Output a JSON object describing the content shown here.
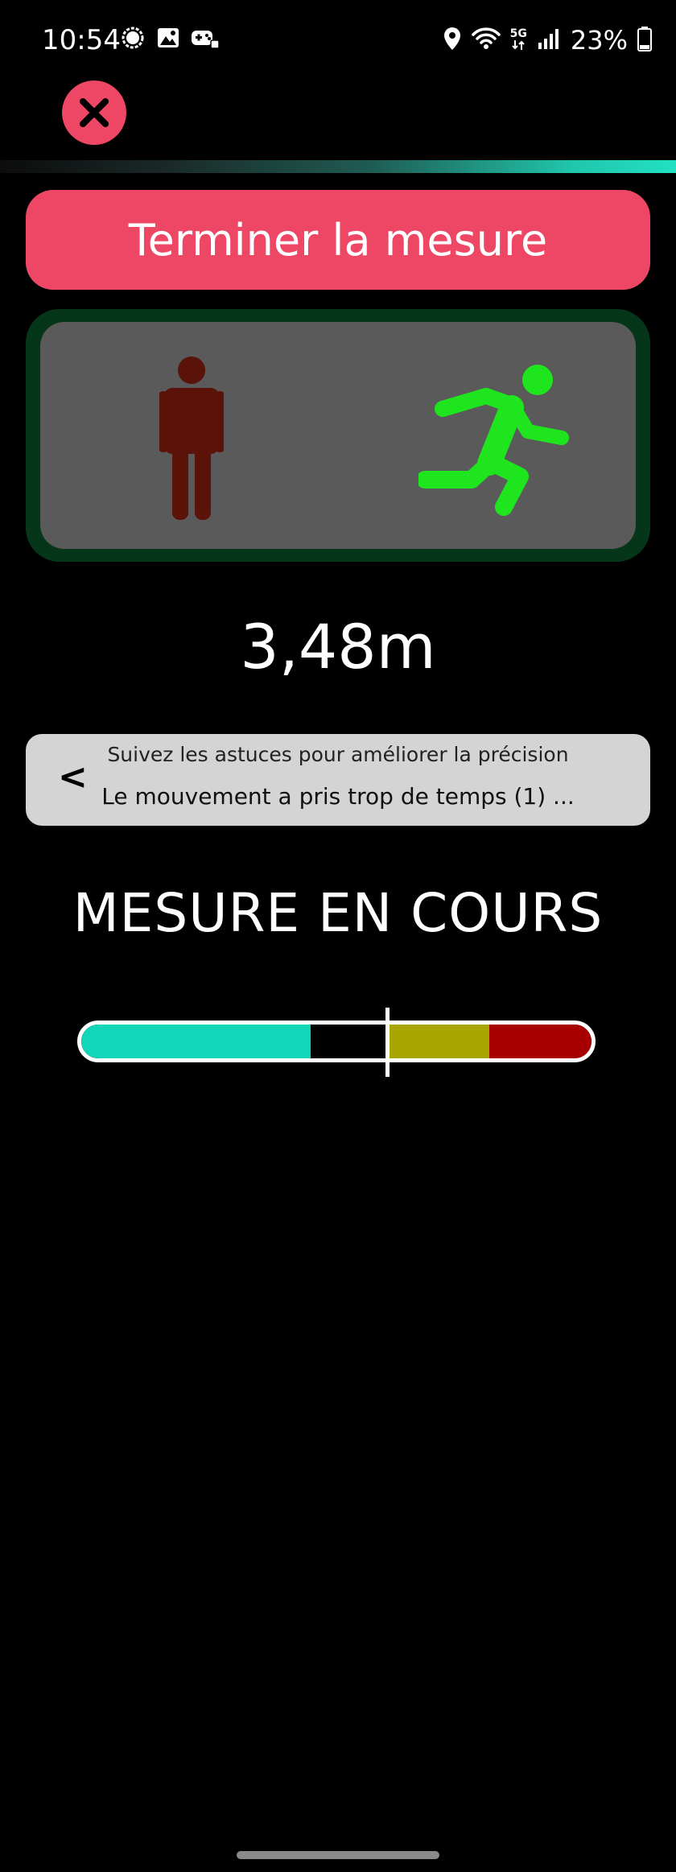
{
  "status_bar": {
    "time": "10:54",
    "left_icons": [
      "signal-messenger-icon",
      "gallery-icon",
      "game-launcher-icon"
    ],
    "right_icons": [
      "location-icon",
      "wifi-icon",
      "5g-icon",
      "cell-signal-icon",
      "battery-icon"
    ],
    "network_label": "5G",
    "battery_percent": "23%"
  },
  "header": {
    "close_icon": "close-icon"
  },
  "finish_button": {
    "label": "Terminer la mesure"
  },
  "motion_panel": {
    "standing_icon": "person-standing-icon",
    "running_icon": "person-running-icon",
    "standing_color": "#5a1209",
    "running_color": "#1ee51e",
    "active": "running"
  },
  "distance": {
    "value": "3,48m"
  },
  "tips": {
    "back_label": "<",
    "title": "Suivez les astuces pour améliorer la précision",
    "message": "Le mouvement a pris trop de temps (1) ..."
  },
  "measure_status": {
    "label": "MESURE EN COURS"
  },
  "gauge": {
    "marker_fraction": 0.6,
    "segments": [
      {
        "color": "#12d6b8",
        "from": 0.0,
        "to": 0.45
      },
      {
        "color": "#000000",
        "from": 0.45,
        "to": 0.6
      },
      {
        "color": "#aaa600",
        "from": 0.6,
        "to": 0.8
      },
      {
        "color": "#a80000",
        "from": 0.8,
        "to": 1.0
      }
    ]
  },
  "colors": {
    "accent": "#ee4766",
    "panel_border": "#063619",
    "panel_fill": "#5a5a5a",
    "tips_fill": "#d4d4d4"
  }
}
